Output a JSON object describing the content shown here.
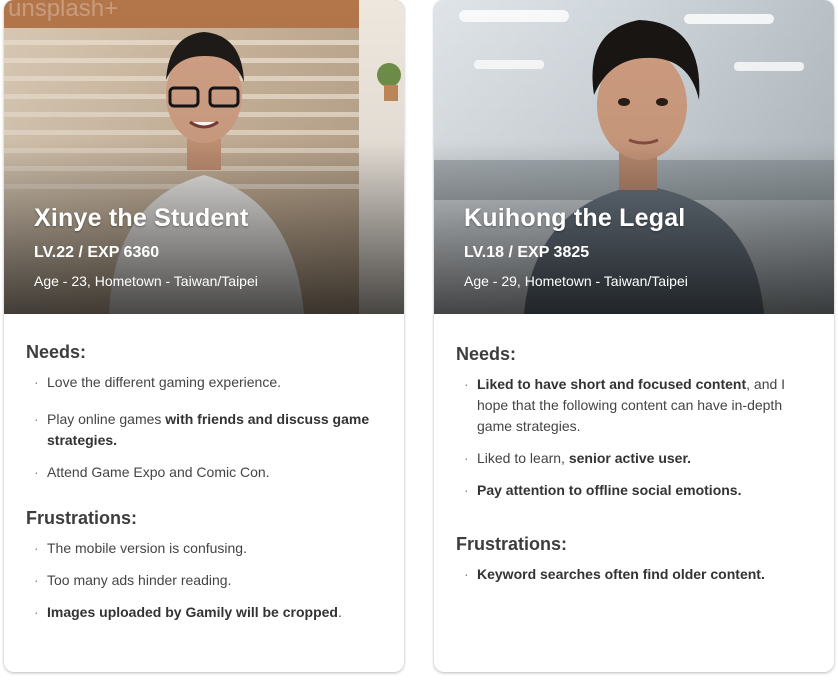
{
  "personas": [
    {
      "name": "Xinye the Student",
      "level": "LV.22 / EXP 6360",
      "meta": "Age - 23, Hometown - Taiwan/Taipei",
      "photo_watermark": "unsplash+",
      "needs_title": "Needs:",
      "needs": [
        {
          "pre": "Love the different gaming experience.",
          "bold": "",
          "post": ""
        },
        {
          "pre": "Play online games ",
          "bold": "with friends and discuss game strategies.",
          "post": ""
        },
        {
          "pre": "Attend Game Expo and Comic Con.",
          "bold": "",
          "post": ""
        }
      ],
      "frustrations_title": "Frustrations:",
      "frustrations": [
        {
          "pre": "The mobile version is confusing.",
          "bold": "",
          "post": ""
        },
        {
          "pre": "Too many ads hinder reading.",
          "bold": "",
          "post": ""
        },
        {
          "pre": "",
          "bold": "Images uploaded by Gamily will be cropped",
          "post": "."
        }
      ]
    },
    {
      "name": "Kuihong the Legal",
      "level": "LV.18 / EXP 3825",
      "meta": "Age - 29, Hometown - Taiwan/Taipei",
      "needs_title": "Needs:",
      "needs": [
        {
          "pre": "",
          "bold": "Liked to have short and focused content",
          "post": ", and I hope that the following content can have in-depth game strategies."
        },
        {
          "pre": "Liked to learn, ",
          "bold": "senior active user.",
          "post": ""
        },
        {
          "pre": "",
          "bold": "Pay attention to  offline social emotions.",
          "post": ""
        }
      ],
      "frustrations_title": "Frustrations:",
      "frustrations": [
        {
          "pre": "",
          "bold": "Keyword searches often find older content.",
          "post": ""
        }
      ]
    }
  ],
  "bullet": "·"
}
